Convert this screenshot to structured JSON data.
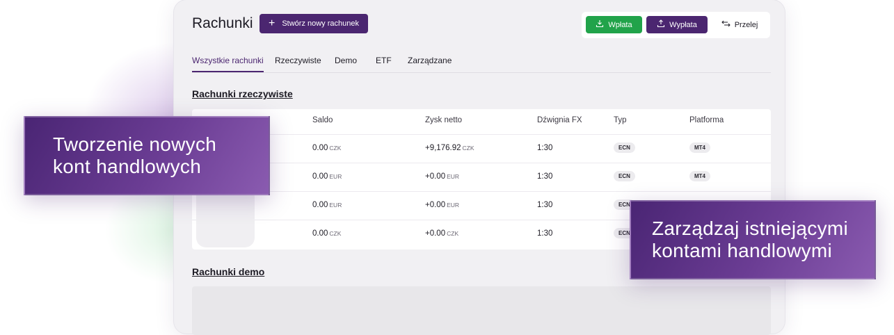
{
  "header": {
    "title": "Rachunki",
    "create_button": "Stwórz nowy rachunek",
    "actions": {
      "deposit": "Wpłata",
      "withdraw": "Wypłata",
      "transfer": "Przelej"
    }
  },
  "tabs": [
    {
      "label": "Wszystkie rachunki",
      "active": true
    },
    {
      "label": "Rzeczywiste",
      "active": false
    },
    {
      "label": "Demo",
      "active": false
    },
    {
      "label": "ETF",
      "active": false
    },
    {
      "label": "Zarządzane",
      "active": false
    }
  ],
  "real_accounts": {
    "title": "Rachunki rzeczywiste",
    "columns": [
      "Saldo",
      "Zysk netto",
      "Dźwignia FX",
      "Typ",
      "Platforma"
    ],
    "rows": [
      {
        "balance": "0.00",
        "balance_unit": "CZK",
        "profit": "+9,176.92",
        "profit_unit": "CZK",
        "leverage": "1:30",
        "type": "ECN",
        "platform": "MT4"
      },
      {
        "balance": "0.00",
        "balance_unit": "EUR",
        "profit": "+0.00",
        "profit_unit": "EUR",
        "leverage": "1:30",
        "type": "ECN",
        "platform": "MT4"
      },
      {
        "balance": "0.00",
        "balance_unit": "EUR",
        "profit": "+0.00",
        "profit_unit": "EUR",
        "leverage": "1:30",
        "type": "ECN",
        "platform": ""
      },
      {
        "balance": "0.00",
        "balance_unit": "CZK",
        "profit": "+0.00",
        "profit_unit": "CZK",
        "leverage": "1:30",
        "type": "ECN",
        "platform": ""
      }
    ]
  },
  "demo_accounts": {
    "title": "Rachunki demo"
  },
  "overlays": {
    "left": {
      "line1": "Tworzenie nowych",
      "line2": "kont handlowych"
    },
    "right": {
      "line1": "Zarządzaj istniejącymi",
      "line2": "kontami handlowymi"
    }
  },
  "colors": {
    "brand_purple": "#4b2670",
    "deposit_green": "#21a34a",
    "background": "#f1f0f3"
  },
  "icons": {
    "create": "plus-icon",
    "deposit": "download-tray-icon",
    "withdraw": "upload-tray-icon",
    "transfer": "transfer-arrows-icon"
  }
}
